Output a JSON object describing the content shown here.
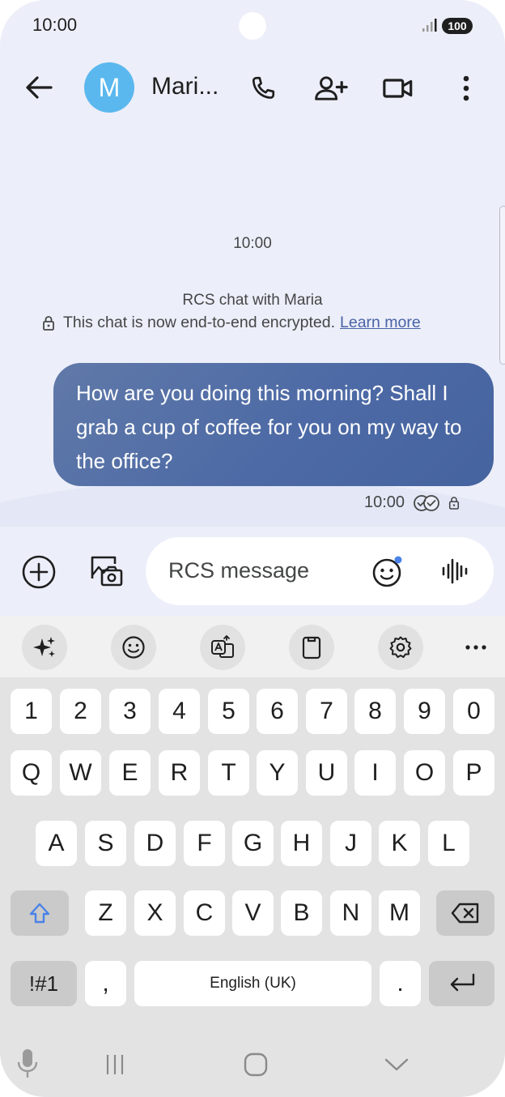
{
  "status_bar": {
    "time": "10:00",
    "battery": "100"
  },
  "app_bar": {
    "avatar_letter": "M",
    "contact_name": "Mari..."
  },
  "conversation": {
    "timestamp": "10:00",
    "rcs_title": "RCS chat with Maria",
    "encryption_text": "This chat is now end-to-end encrypted.",
    "learn_more": "Learn more",
    "message": {
      "text": "How are you doing this morning? Shall I grab a cup of coffee for you on my way to the office?",
      "time": "10:00"
    }
  },
  "compose": {
    "placeholder": "RCS message"
  },
  "keyboard": {
    "number_row": [
      "1",
      "2",
      "3",
      "4",
      "5",
      "6",
      "7",
      "8",
      "9",
      "0"
    ],
    "row1": [
      "Q",
      "W",
      "E",
      "R",
      "T",
      "Y",
      "U",
      "I",
      "O",
      "P"
    ],
    "row2": [
      "A",
      "S",
      "D",
      "F",
      "G",
      "H",
      "J",
      "K",
      "L"
    ],
    "row3": [
      "Z",
      "X",
      "C",
      "V",
      "B",
      "N",
      "M"
    ],
    "symbols_label": "!#1",
    "comma": ",",
    "space_label": "English (UK)",
    "period": "."
  },
  "colors": {
    "background": "#eceef9",
    "bubble": "#4d6aa6",
    "avatar": "#5ab8ee",
    "link": "#4863a6",
    "accent_blue": "#4a82e8"
  },
  "icons": {
    "back": "arrow-left-icon",
    "call": "phone-icon",
    "add_contact": "person-add-icon",
    "video": "videocam-icon",
    "more": "more-vertical-icon",
    "lock": "lock-icon",
    "read_receipt": "double-check-icon",
    "add": "plus-circle-icon",
    "gallery": "gallery-camera-icon",
    "emoji": "emoji-icon",
    "voice": "waveform-icon",
    "ai": "sparkle-icon",
    "translate": "translate-icon",
    "clipboard": "clipboard-icon",
    "settings": "gear-icon",
    "shift": "shift-arrow-icon",
    "backspace": "backspace-icon",
    "enter": "enter-icon",
    "mic": "microphone-icon"
  }
}
